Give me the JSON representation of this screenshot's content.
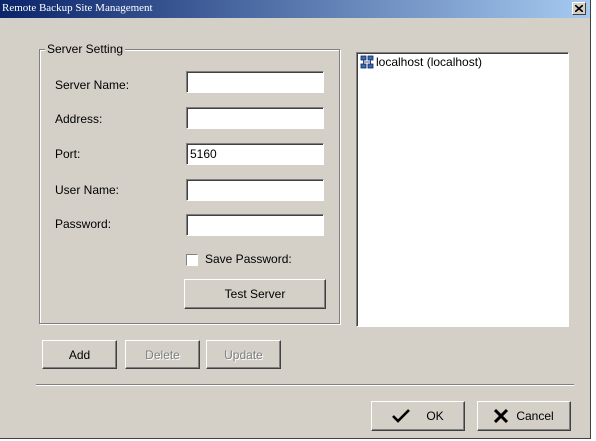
{
  "window": {
    "title": "Remote Backup Site Management",
    "close_glyph": "×"
  },
  "server_setting": {
    "legend": "Server Setting",
    "server_name_label": "Server Name:",
    "server_name_value": "",
    "address_label": "Address:",
    "address_value": "",
    "port_label": "Port:",
    "port_value": "5160",
    "user_name_label": "User Name:",
    "user_name_value": "",
    "password_label": "Password:",
    "password_value": "",
    "save_password_label": "Save Password:",
    "save_password_checked": false,
    "test_server_label": "Test Server"
  },
  "actions": {
    "add_label": "Add",
    "delete_label": "Delete",
    "update_label": "Update"
  },
  "tree": {
    "items": [
      {
        "label": "localhost (localhost)",
        "icon": "server-network-icon"
      }
    ]
  },
  "footer": {
    "ok_label": "OK",
    "ok_icon": "checkmark-icon",
    "cancel_label": "Cancel",
    "cancel_icon": "x-mark-icon"
  },
  "colors": {
    "titlebar_start": "#0a246a",
    "titlebar_end": "#a6caf0",
    "face": "#d4d0c8"
  }
}
